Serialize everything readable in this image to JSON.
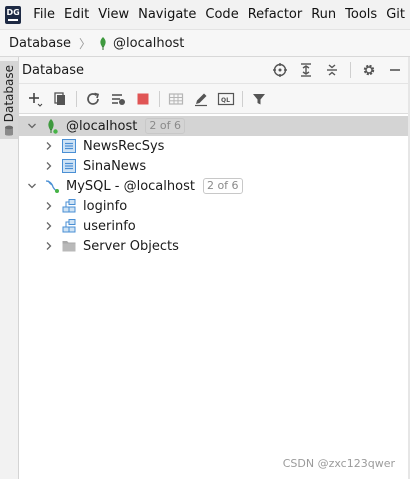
{
  "app": {
    "logo_text": "DG"
  },
  "menu": {
    "items": [
      "File",
      "Edit",
      "View",
      "Navigate",
      "Code",
      "Refactor",
      "Run",
      "Tools",
      "Git"
    ]
  },
  "breadcrumb": {
    "root": "Database",
    "current": "@localhost"
  },
  "sidebar": {
    "tab_label": "Database"
  },
  "panel": {
    "title": "Database"
  },
  "tree": {
    "nodes": [
      {
        "label": "@localhost",
        "badge": "2 of 6",
        "expanded": true,
        "selected": true,
        "icon": "mongodb-leaf-icon"
      },
      {
        "label": "NewsRecSys",
        "icon": "database-icon"
      },
      {
        "label": "SinaNews",
        "icon": "database-icon"
      },
      {
        "label": "MySQL - @localhost",
        "badge": "2 of 6",
        "expanded": true,
        "icon": "mysql-dolphin-icon"
      },
      {
        "label": "loginfo",
        "icon": "schema-icon"
      },
      {
        "label": "userinfo",
        "icon": "schema-icon"
      },
      {
        "label": "Server Objects",
        "icon": "folder-icon"
      }
    ]
  },
  "watermark": "CSDN @zxc123qwer",
  "colors": {
    "mongo_green": "#3f9a3f",
    "stop_red": "#e05555",
    "db_blue": "#4a8fd4",
    "selected_row": "#d4d4d4"
  }
}
